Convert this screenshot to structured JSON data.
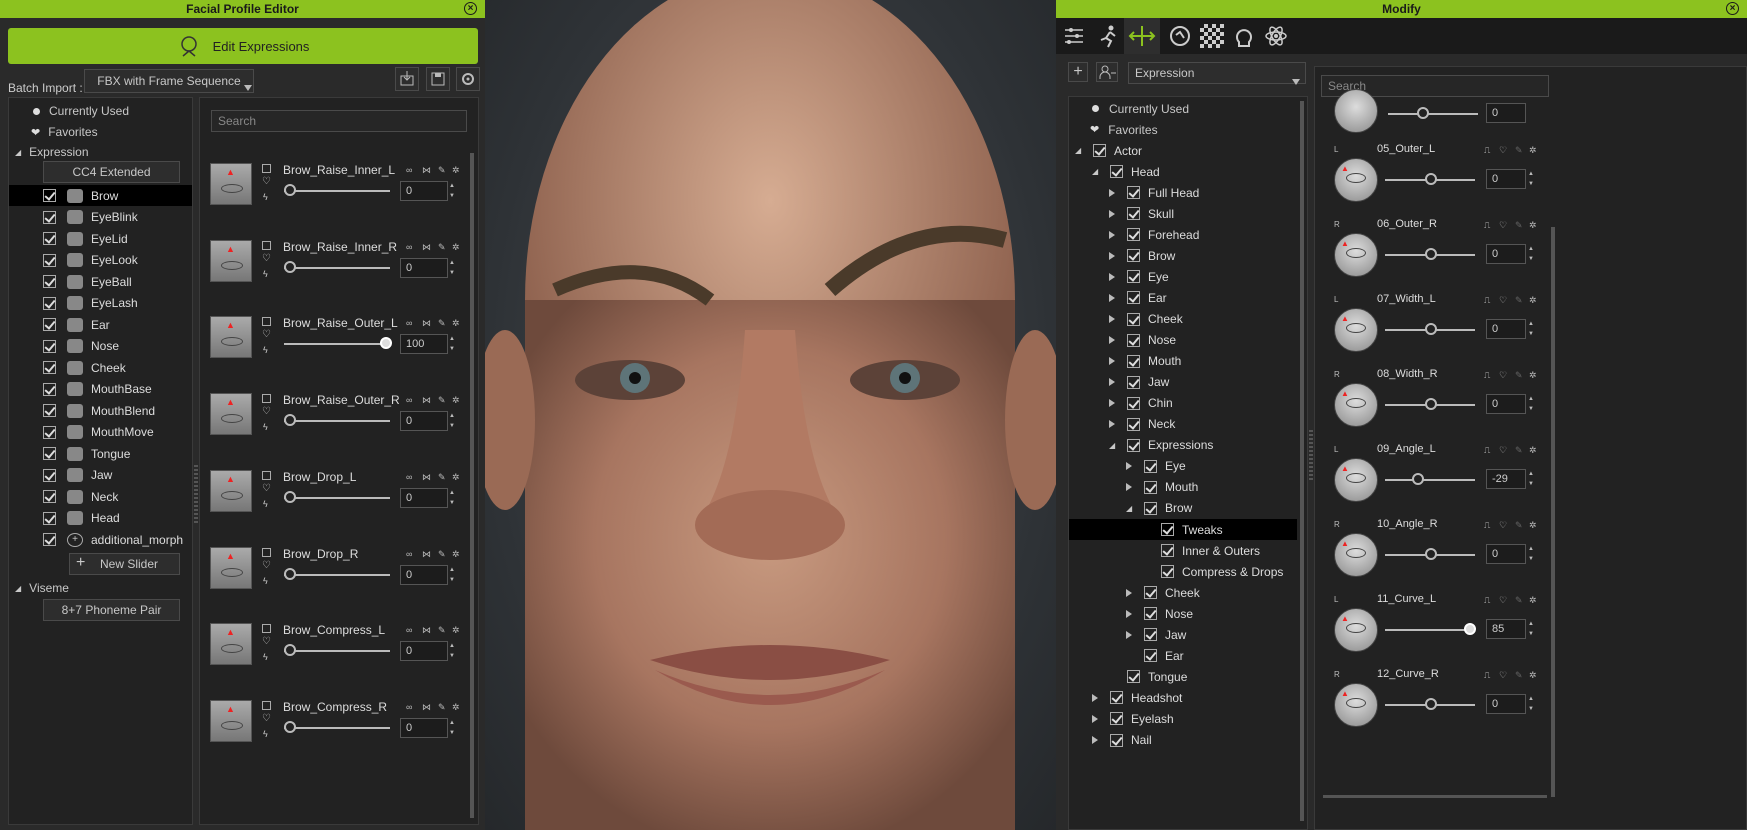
{
  "left": {
    "title": "Facial Profile Editor",
    "edit_btn": "Edit Expressions",
    "batch_label": "Batch Import :",
    "batch_value": "FBX with Frame Sequence",
    "currently_used": "Currently Used",
    "favorites": "Favorites",
    "expression": "Expression",
    "cc4": "CC4 Extended",
    "categories": [
      "Brow",
      "EyeBlink",
      "EyeLid",
      "EyeLook",
      "EyeBall",
      "EyeLash",
      "Ear",
      "Nose",
      "Cheek",
      "MouthBase",
      "MouthBlend",
      "MouthMove",
      "Tongue",
      "Jaw",
      "Neck",
      "Head",
      "additional_morph"
    ],
    "new_slider": "New Slider",
    "viseme": "Viseme",
    "phoneme": "8+7 Phoneme Pair",
    "search_ph": "Search",
    "sliders": [
      {
        "name": "Brow_Raise_Inner_L",
        "value": "0",
        "pct": 0
      },
      {
        "name": "Brow_Raise_Inner_R",
        "value": "0",
        "pct": 0
      },
      {
        "name": "Brow_Raise_Outer_L",
        "value": "100",
        "pct": 100
      },
      {
        "name": "Brow_Raise_Outer_R",
        "value": "0",
        "pct": 0
      },
      {
        "name": "Brow_Drop_L",
        "value": "0",
        "pct": 0
      },
      {
        "name": "Brow_Drop_R",
        "value": "0",
        "pct": 0
      },
      {
        "name": "Brow_Compress_L",
        "value": "0",
        "pct": 0
      },
      {
        "name": "Brow_Compress_R",
        "value": "0",
        "pct": 0
      }
    ]
  },
  "right": {
    "title": "Modify",
    "dropdown": "Expression",
    "search_ph": "Search",
    "tree": [
      {
        "label": "Currently Used",
        "lvl": 0,
        "kind": "dot"
      },
      {
        "label": "Favorites",
        "lvl": 0,
        "kind": "heart"
      },
      {
        "label": "Actor",
        "lvl": 0,
        "kind": "open"
      },
      {
        "label": "Head",
        "lvl": 1,
        "kind": "open"
      },
      {
        "label": "Full Head",
        "lvl": 2,
        "kind": "closed"
      },
      {
        "label": "Skull",
        "lvl": 2,
        "kind": "closed"
      },
      {
        "label": "Forehead",
        "lvl": 2,
        "kind": "closed"
      },
      {
        "label": "Brow",
        "lvl": 2,
        "kind": "closed"
      },
      {
        "label": "Eye",
        "lvl": 2,
        "kind": "closed"
      },
      {
        "label": "Ear",
        "lvl": 2,
        "kind": "closed"
      },
      {
        "label": "Cheek",
        "lvl": 2,
        "kind": "closed"
      },
      {
        "label": "Nose",
        "lvl": 2,
        "kind": "closed"
      },
      {
        "label": "Mouth",
        "lvl": 2,
        "kind": "closed"
      },
      {
        "label": "Jaw",
        "lvl": 2,
        "kind": "closed"
      },
      {
        "label": "Chin",
        "lvl": 2,
        "kind": "closed"
      },
      {
        "label": "Neck",
        "lvl": 2,
        "kind": "closed"
      },
      {
        "label": "Expressions",
        "lvl": 2,
        "kind": "open"
      },
      {
        "label": "Eye",
        "lvl": 3,
        "kind": "closed"
      },
      {
        "label": "Mouth",
        "lvl": 3,
        "kind": "closed"
      },
      {
        "label": "Brow",
        "lvl": 3,
        "kind": "open"
      },
      {
        "label": "Tweaks",
        "lvl": 4,
        "kind": "leaf",
        "selected": true
      },
      {
        "label": "Inner & Outers",
        "lvl": 4,
        "kind": "leaf"
      },
      {
        "label": "Compress & Drops",
        "lvl": 4,
        "kind": "leaf"
      },
      {
        "label": "Cheek",
        "lvl": 3,
        "kind": "closed"
      },
      {
        "label": "Nose",
        "lvl": 3,
        "kind": "closed"
      },
      {
        "label": "Jaw",
        "lvl": 3,
        "kind": "closed"
      },
      {
        "label": "Ear",
        "lvl": 3,
        "kind": "leaf"
      },
      {
        "label": "Tongue",
        "lvl": 2,
        "kind": "leaf"
      },
      {
        "label": "Headshot",
        "lvl": 1,
        "kind": "closed"
      },
      {
        "label": "Eyelash",
        "lvl": 1,
        "kind": "closed"
      },
      {
        "label": "Nail",
        "lvl": 1,
        "kind": "closed"
      }
    ],
    "top_value": "0",
    "sliders": [
      {
        "side": "L",
        "name": "05_Outer_L",
        "value": "0",
        "pct": 50
      },
      {
        "side": "R",
        "name": "06_Outer_R",
        "value": "0",
        "pct": 50
      },
      {
        "side": "L",
        "name": "07_Width_L",
        "value": "0",
        "pct": 50
      },
      {
        "side": "R",
        "name": "08_Width_R",
        "value": "0",
        "pct": 50
      },
      {
        "side": "L",
        "name": "09_Angle_L",
        "value": "-29",
        "pct": 36
      },
      {
        "side": "R",
        "name": "10_Angle_R",
        "value": "0",
        "pct": 50
      },
      {
        "side": "L",
        "name": "11_Curve_L",
        "value": "85",
        "pct": 92
      },
      {
        "side": "R",
        "name": "12_Curve_R",
        "value": "0",
        "pct": 50
      }
    ]
  }
}
